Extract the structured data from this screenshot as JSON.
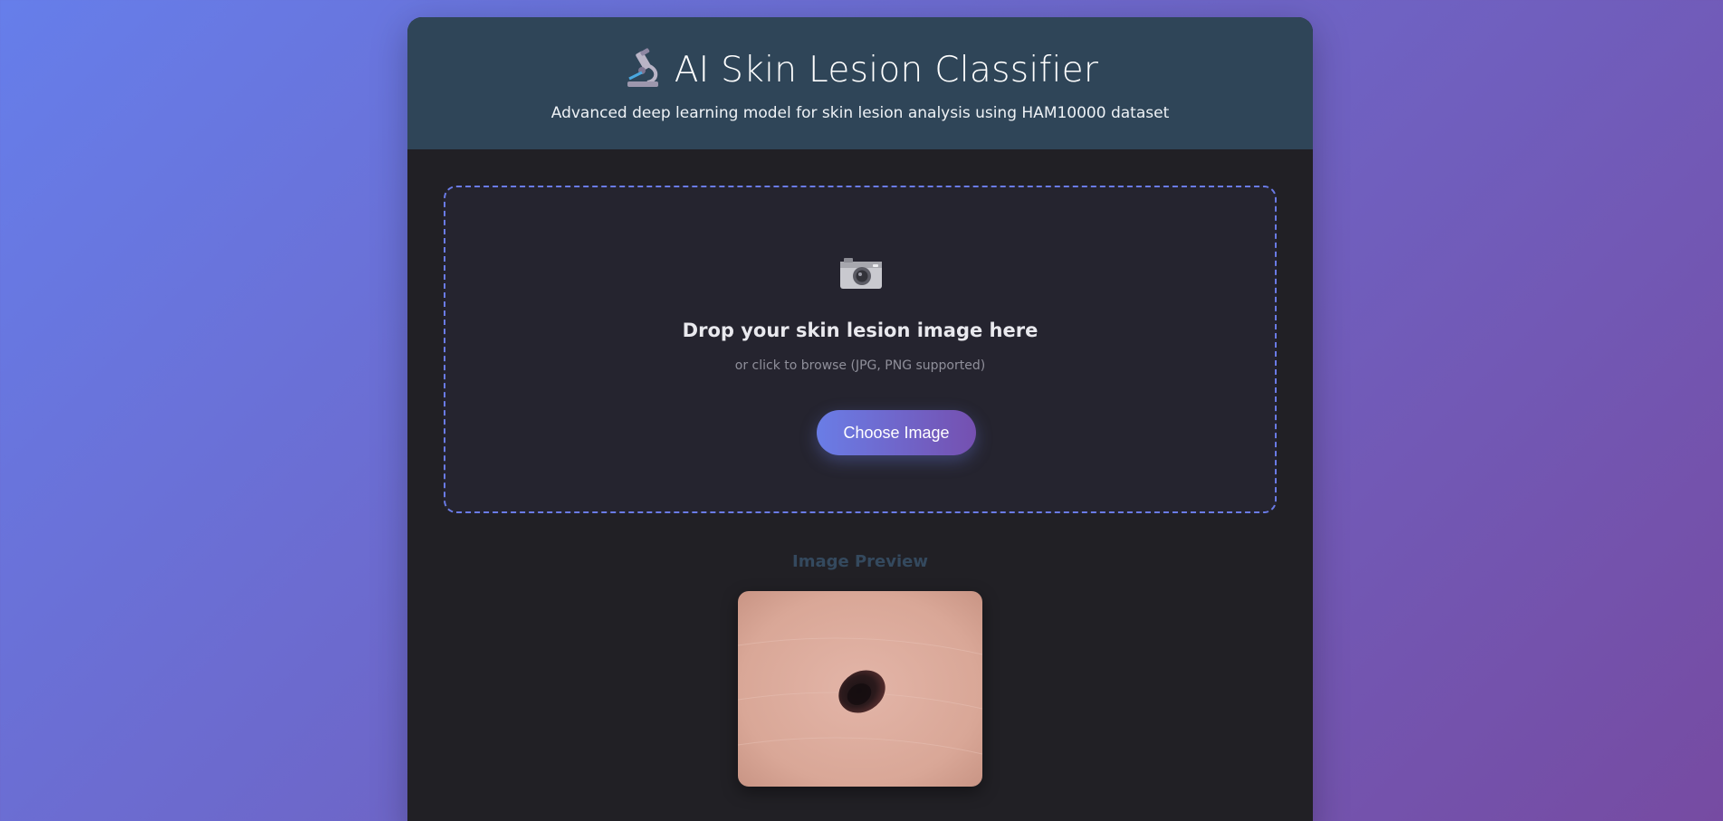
{
  "header": {
    "icon": "microscope-icon",
    "title": "AI Skin Lesion Classifier",
    "subtitle": "Advanced deep learning model for skin lesion analysis using HAM10000 dataset"
  },
  "upload": {
    "icon": "camera-icon",
    "title": "Drop your skin lesion image here",
    "hint": "or click to browse (JPG, PNG supported)",
    "button_label": "Choose Image"
  },
  "preview": {
    "heading": "Image Preview"
  },
  "colors": {
    "background_start": "#667eea",
    "background_end": "#764ba2",
    "header_bg": "#2f4558",
    "card_bg": "#212025",
    "dashed_border": "#6a7be6",
    "button_start": "#6a7de6",
    "button_end": "#7550b0"
  }
}
